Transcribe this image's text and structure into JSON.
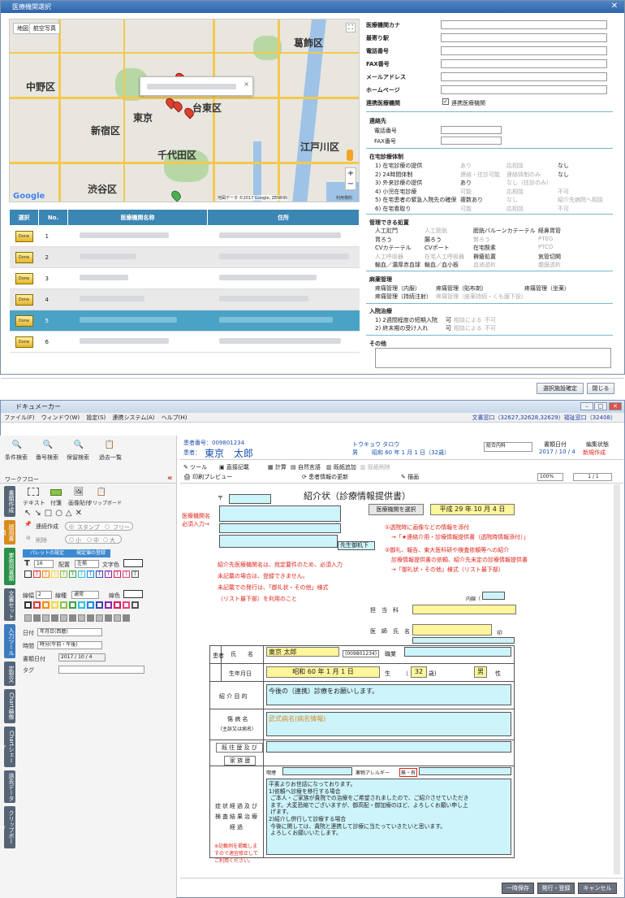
{
  "dialog": {
    "title": "医療機関選択",
    "map_tabs": [
      "地図",
      "航空写真"
    ],
    "map_labels": {
      "nakano": "中野区",
      "shinjuku": "新宿区",
      "tokyo": "東京",
      "taito": "台東区",
      "chiyoda": "千代田区",
      "edogawa": "江戸川区",
      "katsushika": "葛飾区",
      "shibuya": "渋谷区",
      "google": "Google",
      "copyright": "地図データ ©2017 Google, ZENRIN",
      "terms": "利用規約"
    },
    "pins": [
      "1",
      "6",
      "4",
      "5"
    ],
    "table": {
      "headers": [
        "選択",
        "No.",
        "医療機関名称",
        "住所"
      ],
      "rows": [
        "1",
        "2",
        "3",
        "4",
        "5",
        "6"
      ],
      "select_label": "Done"
    },
    "fields": [
      "医療機関カナ",
      "最寄り駅",
      "電話番号",
      "FAX番号",
      "メールアドレス",
      "ホームページ"
    ],
    "coop_label": "連携医療機関",
    "coop_check": "連携医療機関",
    "contact": {
      "title": "連絡先",
      "tel": "電話番号",
      "fax": "FAX番号"
    },
    "home_care": {
      "title": "在宅診療体制",
      "items": [
        {
          "label": "1) 在宅診療の提供",
          "c1": "あり",
          "c2": "応相談",
          "c3": "なし"
        },
        {
          "label": "2) 24時間体制",
          "c1": "連絡・往診可能",
          "c2": "連絡体制のみ",
          "c3": "なし"
        },
        {
          "label": "3) 外来診療の提供",
          "c1": "あり",
          "c2": "なし（往診のみ）",
          "c3": ""
        },
        {
          "label": "4) 小児在宅診療",
          "c1": "可能",
          "c2": "応相談",
          "c3": "不可"
        },
        {
          "label": "5) 在宅患者の緊急入院先の確保",
          "c1": "複数あり",
          "c2": "なし",
          "c3": "紹介先病院へ相談"
        },
        {
          "label": "6) 在宅看取り",
          "c1": "可能",
          "c2": "応相談",
          "c3": "不可"
        }
      ]
    },
    "mgmt": {
      "title": "管理できる処置",
      "items": [
        "人工肛門",
        "人工膀胱",
        "膀胱バルーンカテーテル",
        "経鼻胃管",
        "胃ろう",
        "腸ろう",
        "腎ろう",
        "PTEG",
        "CVカテーテル",
        "CVポート",
        "在宅酸素",
        "PTCD",
        "人工呼吸器",
        "在宅人工呼吸器",
        "褥瘡処置",
        "気管切開",
        "輸血／濃厚赤血球",
        "輸血／血小板",
        "血液透析",
        "腹膜透析"
      ]
    },
    "narcotic": {
      "title": "麻薬管理",
      "items": [
        "疼痛管理（内服）",
        "疼痛管理（貼布剤）",
        "疼痛管理（坐薬）",
        "疼痛管理（持続注射）",
        "疼痛管理（座薬持続・くも膜下投）"
      ]
    },
    "admission": {
      "title": "入院治療",
      "items": [
        {
          "label": "1) 2週間程度の短期入院",
          "a": "可",
          "b": "相談による",
          "c": "不可"
        },
        {
          "label": "2) 終末期の受け入れ",
          "a": "可",
          "b": "相談による",
          "c": "不可"
        }
      ]
    },
    "other": "その他",
    "confirm": "選択施設確定",
    "close": "閉じる"
  },
  "app": {
    "title": "ドキュメーカー",
    "menu": [
      "ファイル(F)",
      "ウィンドウ(W)",
      "設定(S)",
      "連携システム(A)",
      "ヘルプ(H)"
    ],
    "status": "文書窓口（32627,32628,32629）福祉窓口（32408）",
    "toolbar": [
      "条件検索",
      "番号検索",
      "保留検索",
      "過去一覧"
    ],
    "workflow": "ワークフロー",
    "tabs": [
      "書類作成",
      "顔用書類",
      "業務用書類",
      "文書セット",
      "入力ツール",
      "定型文",
      "Chart画像",
      "Chartシェーマ",
      "過去データ",
      "クリップボード"
    ],
    "tools": {
      "text": "テキスト",
      "stamp": "付箋",
      "imgpaste": "画像貼付",
      "clip": "クリップボード",
      "palette": "パレットの設定",
      "fixed": "規定値の登録",
      "continuous": "連続作成",
      "del": "削除",
      "stamp2": "スタンプ",
      "free": "フリー",
      "small": "小",
      "mid": "中",
      "large": "大",
      "font": "T",
      "size": "16",
      "align": "配置",
      "align_val": "左揃",
      "fcolor": "文字色",
      "lw": "線幅",
      "lw_val": "2",
      "lt": "線種",
      "lt_val": "通常",
      "lc": "線色",
      "date": "日付",
      "date_val": "年月日(西暦)",
      "time": "時間",
      "time_val": "時分(午前・午後)",
      "docdate": "書類日付",
      "docdate_val": "2017 / 10 / 4",
      "tag": "タグ"
    },
    "patient": {
      "no_label": "患者番号：",
      "no": "009801234",
      "name_label": "患者：",
      "name": "東京　太郎",
      "kana": "トウキョウ タロウ",
      "sex": "男",
      "birth": "昭和 60 年 1 月 1 日（32歳）",
      "dept": "総合内科",
      "docdate_label": "書類日付",
      "docdate": "2017 / 10 / 4",
      "status_label": "編集状態",
      "status": "新規作成"
    },
    "doc_tools": [
      "ツール",
      "直接記載",
      "計算",
      "自然言語",
      "既紙追加",
      "既紙削除",
      "印刷プレビュー",
      "患者情報の更新",
      "描画"
    ],
    "zoom": "100%",
    "page": "1 / 1",
    "letter": {
      "title": "紹介状（診療情報提供書）",
      "select_btn": "医療機関を選択",
      "date": "平成 29 年 10 月 4 日",
      "dest_note1": "医療機関名",
      "dest_note2": "必須入力→",
      "postal": "〒",
      "doctor_suffix": "先生御机下",
      "red1": "紹介先医療機関名は、宛定要件のため、必須入力",
      "red2": "未記載の場合は、登録できません。",
      "red3": "未記載での発行は、「御礼状・その他」様式",
      "red4": "（リスト最下部）を利用のこと",
      "red5": "①透院時に画像などの情報を添付",
      "red6": "→「★連絡介用・診療情報提供書（透院時情報添付）」",
      "red7": "②御礼、報告、東大医科研や検査依頼等への紹介",
      "red8": "診療情報提供書の依頼、紹介先未定の診療情報提供書",
      "red9": "→「御礼状・その他」様式（リスト最下部）",
      "internal": "内線（",
      "dept": "担　当　科",
      "doctor": "医　師　氏　名",
      "seal": "㊞",
      "pt": "患者",
      "pt_name_l": "氏　　名",
      "pt_name": "東京 太郎",
      "pt_no": "(009801234)",
      "job": "職業",
      "birth_l": "生年月日",
      "birth": "昭和 60 年 1 月 1 日",
      "birth_suffix": "生",
      "age": "32",
      "age_unit": "歳)",
      "sex": "男",
      "sex_l": "性",
      "purpose_l": "紹 介 目 的",
      "purpose": "今後の（連携）診療をお願いします。",
      "dx_l": "傷 病 名",
      "dx_sub": "（主訴又は病名）",
      "dx": "武式病名(病名情報)",
      "hist_l": "既 往 歴 及 び",
      "fam_l": "家 族 歴",
      "smoke": "喫煙",
      "allergy": "薬物アレルギー",
      "nothing": "無・有",
      "course_l": "症状経過及び検査結果治療経過",
      "course": "平素よりお世話になっております。\n1)依頼へ診療を移行する場合\n ご本人・ご家族が貴院での治療をご希望されましたので、ご紹介させていただき\n ます。大変恐縮でございますが、御高配・御加療のほど、よろしくお願い申し上\n げます。\n2)紹介し併行して診療する場合\n 今後に関しては、貴院と連携して診療に当たっていきたいと思います。\n よろしくお願いいたします。",
      "course_note": "※記載例を掲載しますので適宜修正してご利用ください。"
    },
    "bottom": [
      "一時保存",
      "発行・登録",
      "キャンセル"
    ]
  }
}
